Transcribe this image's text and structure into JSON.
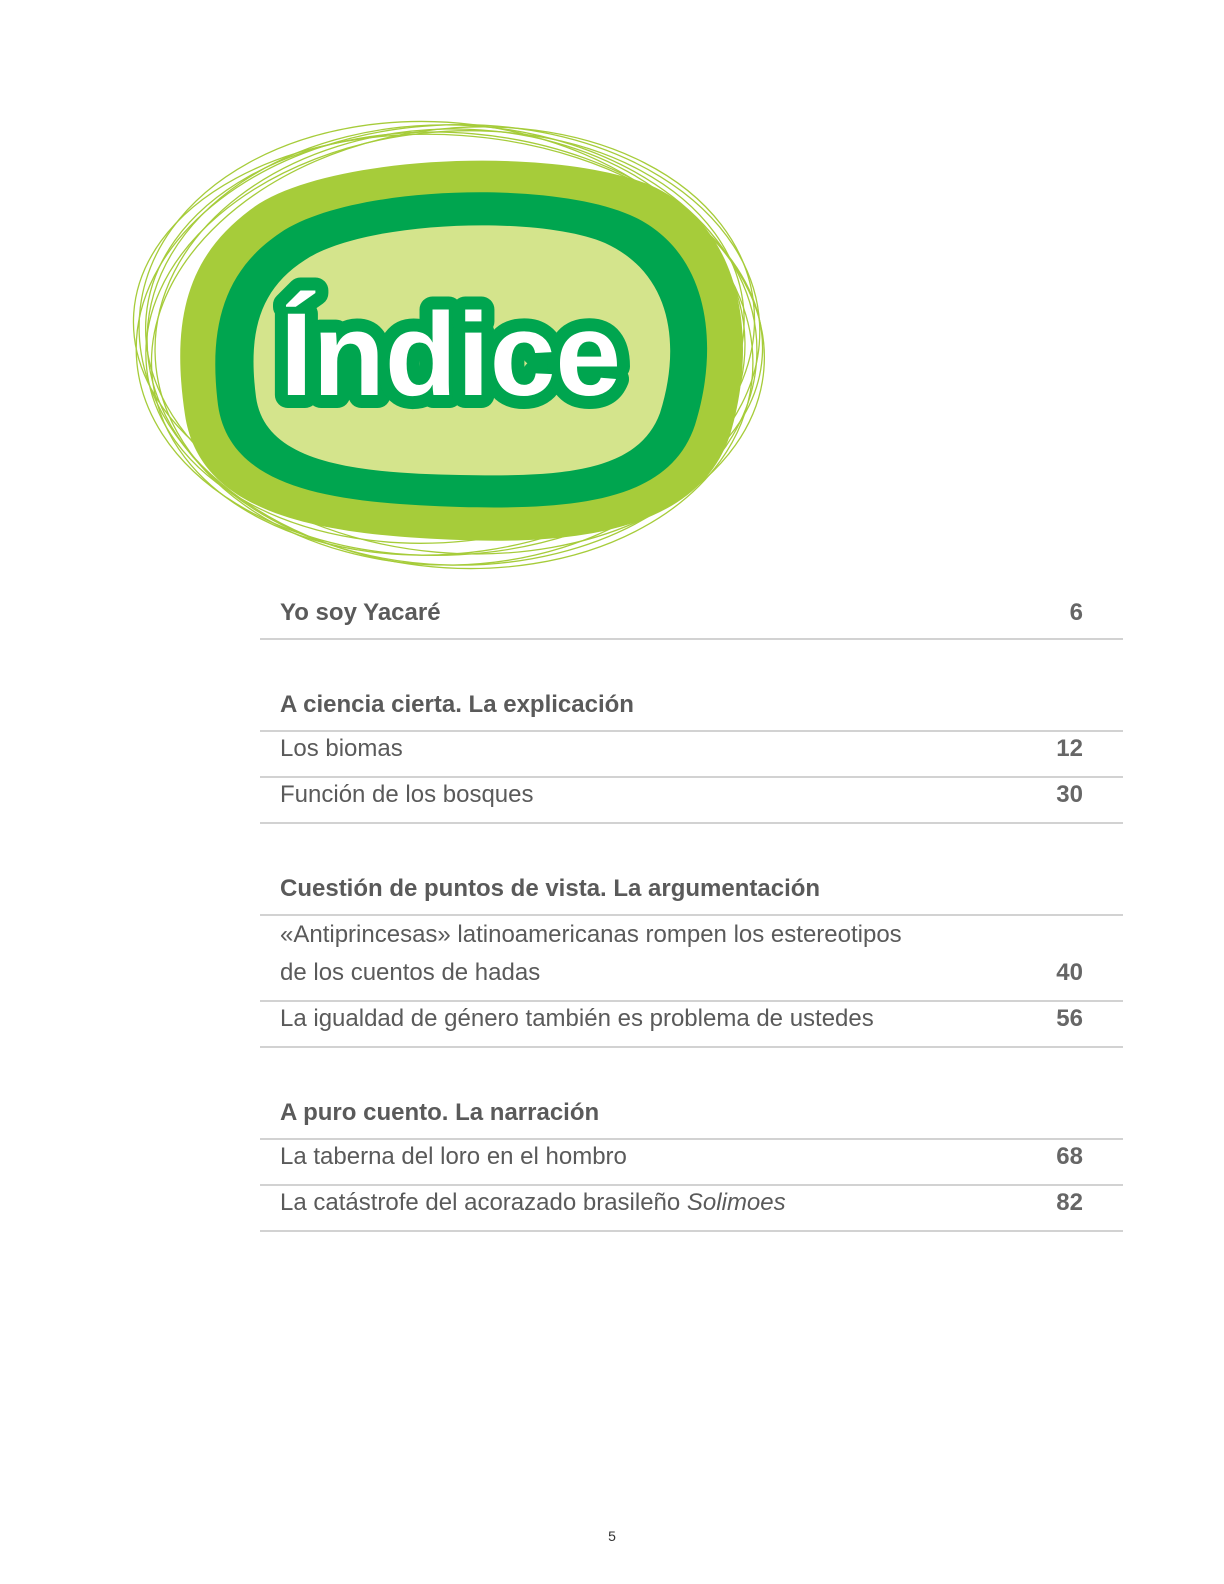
{
  "page_title": "Índice",
  "colors": {
    "outer_green": "#a6cc3a",
    "inner_green": "#00a54f",
    "center_green": "#d4e48c",
    "scribble_green": "#a6cc3a",
    "text_gray": "#5a5a5a",
    "rule_gray": "#d2d2d2"
  },
  "toc": {
    "sections": [
      {
        "title": "Yo soy Yacaré",
        "page": "6",
        "items": []
      },
      {
        "title": "A ciencia cierta. La explicación",
        "page": "",
        "items": [
          {
            "label": "Los biomas",
            "page": "12"
          },
          {
            "label": "Función de los bosques",
            "page": "30"
          }
        ]
      },
      {
        "title": "Cuestión de puntos de vista. La argumentación",
        "page": "",
        "items": [
          {
            "label_line1": "«Antiprincesas» latinoamericanas rompen los estereotipos",
            "label_line2": "de los cuentos de hadas",
            "page": "40"
          },
          {
            "label": "La igualdad de género también es problema de ustedes",
            "page": "56"
          }
        ]
      },
      {
        "title": "A puro cuento. La narración",
        "page": "",
        "items": [
          {
            "label": "La taberna del loro en el hombro",
            "page": "68"
          },
          {
            "label_plain": "La catástrofe del acorazado brasileño ",
            "label_italic": "Solimoes",
            "page": "82"
          }
        ]
      }
    ]
  },
  "page_number": "5"
}
